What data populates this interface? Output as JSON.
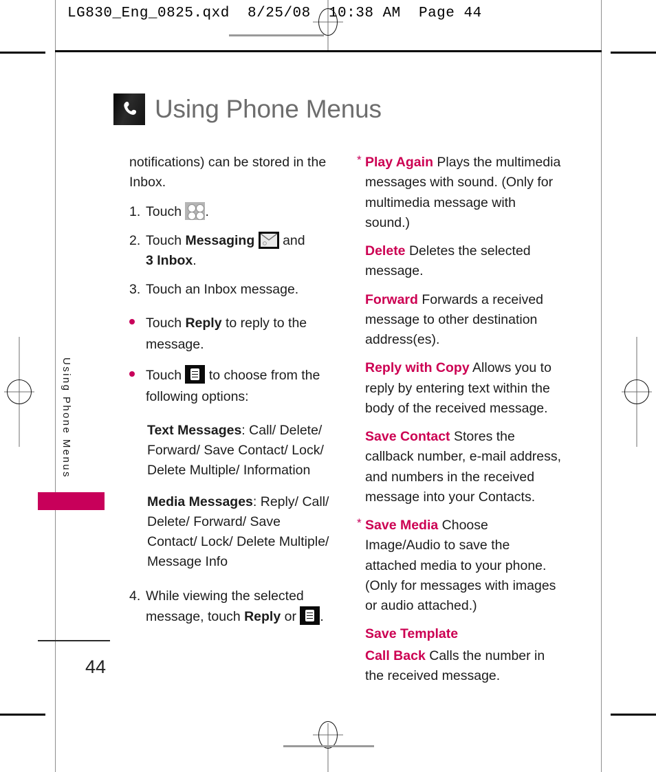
{
  "print_slug": "LG830_Eng_0825.qxd  8/25/08  10:38 AM  Page 44",
  "header": {
    "title": "Using Phone Menus",
    "badge_icon": "phone-handset-icon"
  },
  "side_tab": {
    "label": "Using Phone Menus"
  },
  "colors": {
    "accent_pink": "#c8005a",
    "term_pink": "#cc0052",
    "title_gray": "#6d6d6d",
    "body": "#1c1c1c"
  },
  "left_column": {
    "intro": "notifications) can be stored in the Inbox.",
    "steps": [
      {
        "number": "1.",
        "pre": "Touch ",
        "icon": "grid-menu-icon",
        "post": "."
      },
      {
        "number": "2.",
        "pre": "Touch ",
        "bold1": "Messaging",
        "icon": "envelope-icon",
        "mid": " and ",
        "bold2": "3 Inbox",
        "post": "."
      },
      {
        "number": "3.",
        "text": "Touch an Inbox message."
      },
      {
        "number": "4.",
        "pre": "While viewing the selected message, touch ",
        "bold1": "Reply",
        "mid": " or ",
        "icon": "list-menu-icon",
        "post": "."
      }
    ],
    "bullets": [
      {
        "pre": "Touch ",
        "bold": "Reply",
        "post": " to reply to the message."
      },
      {
        "pre": "Touch ",
        "icon": "list-menu-icon",
        "post": " to choose from the following options:"
      }
    ],
    "option_lists": [
      {
        "label": "Text Messages",
        "separator": ": ",
        "items": "Call/ Delete/ Forward/ Save Contact/ Lock/ Delete Multiple/ Information"
      },
      {
        "label": "Media Messages",
        "separator": ": ",
        "items": "Reply/ Call/ Delete/ Forward/ Save Contact/ Lock/ Delete Multiple/ Message Info"
      }
    ]
  },
  "right_column": {
    "options": [
      {
        "star": "*",
        "term": "Play Again",
        "description": " Plays the multimedia messages with sound. (Only for multimedia message with sound.)"
      },
      {
        "star": "",
        "term": "Delete",
        "description": " Deletes the selected message."
      },
      {
        "star": "",
        "term": "Forward",
        "description": " Forwards a received message to other destination address(es)."
      },
      {
        "star": "",
        "term": "Reply with Copy",
        "description": " Allows you to reply by entering text within the body of the received message."
      },
      {
        "star": "",
        "term": "Save Contact",
        "description": " Stores the callback number, e-mail address, and numbers in the received message into your Contacts."
      },
      {
        "star": "*",
        "term": "Save Media",
        "description": " Choose Image/Audio to save the attached media to your phone. (Only for messages with images or audio attached.)"
      },
      {
        "star": "",
        "term": "Save Template",
        "description": ""
      },
      {
        "star": "",
        "term": "Call Back",
        "description": " Calls the number in the received message."
      }
    ]
  },
  "footer": {
    "page_number": "44"
  }
}
